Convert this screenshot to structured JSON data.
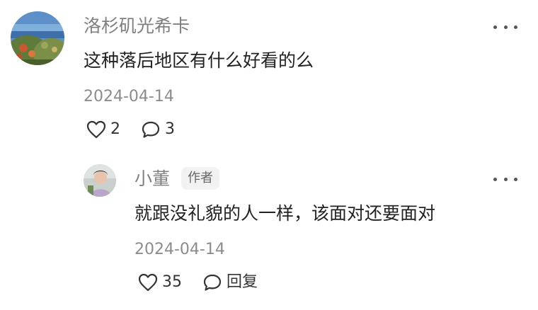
{
  "comments": [
    {
      "author": "洛杉矶光希卡",
      "content": "这种落后地区有什么好看的么",
      "date": "2024-04-14",
      "like_count": "2",
      "reply_count": "3",
      "like_icon": "heart-outline-icon",
      "reply_icon": "chat-bubble-icon",
      "more_icon": "more-dots-icon"
    }
  ],
  "replies": [
    {
      "author": "小董",
      "badge": "作者",
      "content": "就跟没礼貌的人一样，该面对还要面对",
      "date": "2024-04-14",
      "like_count": "35",
      "reply_label": "回复",
      "like_icon": "heart-outline-icon",
      "reply_icon": "chat-bubble-icon",
      "more_icon": "more-dots-icon"
    }
  ]
}
